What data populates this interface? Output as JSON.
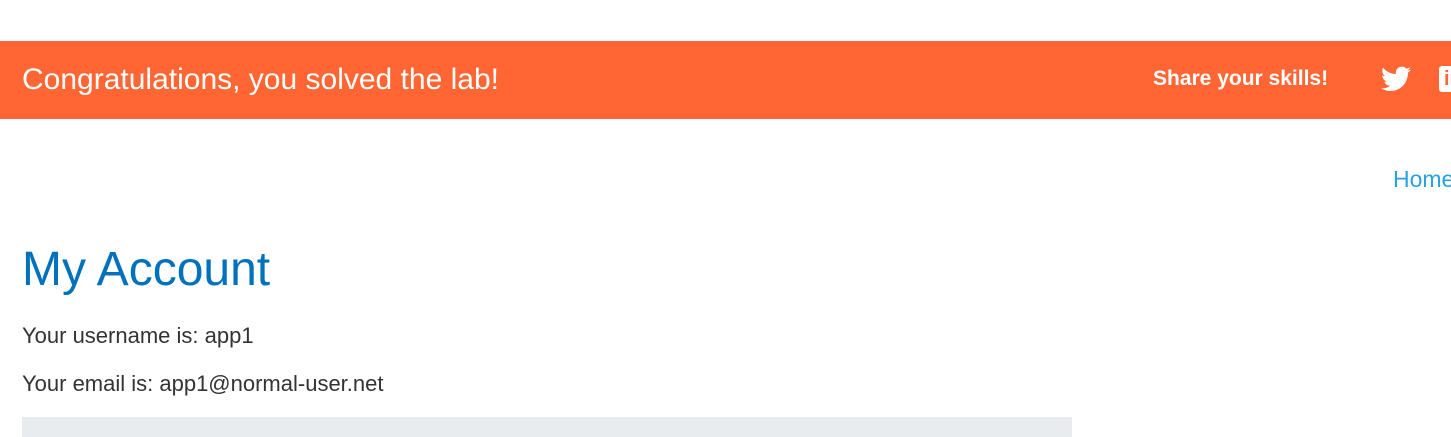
{
  "banner": {
    "message": "Congratulations, you solved the lab!",
    "share_label": "Share your skills!",
    "background_color": "#ff6633",
    "icons": [
      "twitter-icon",
      "linkedin-icon"
    ],
    "linkedin_glyph": "in"
  },
  "nav": {
    "home_label": "Home"
  },
  "account": {
    "title": "My Account",
    "username_line": "Your username is: app1",
    "email_line": "Your email is: app1@normal-user.net"
  },
  "colors": {
    "title": "#0071bc",
    "link": "#29a3e0",
    "text": "#333333"
  }
}
